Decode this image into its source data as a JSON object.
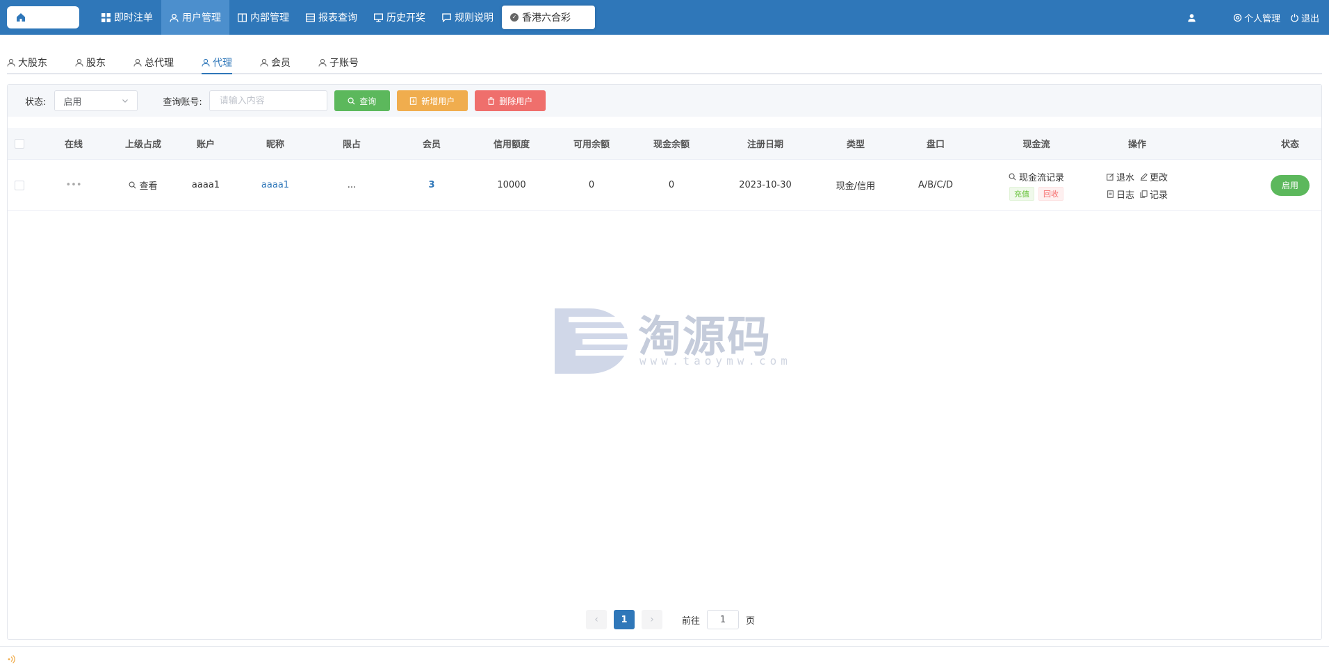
{
  "topbar": {
    "nav": [
      "即时注单",
      "用户管理",
      "内部管理",
      "报表查询",
      "历史开奖",
      "规则说明"
    ],
    "active_nav": "用户管理",
    "lottery": "香港六合彩",
    "right": [
      "个人管理",
      "退出"
    ],
    "accent": "#2f77b9"
  },
  "tabs": [
    "大股东",
    "股东",
    "总代理",
    "代理",
    "会员",
    "子账号"
  ],
  "active_tab": "代理",
  "filter": {
    "status_label": "状态:",
    "status_value": "启用",
    "query_label": "查询账号:",
    "query_placeholder": "请输入内容",
    "search_btn": "查询",
    "add_btn": "新增用户",
    "delete_btn": "删除用户"
  },
  "table": {
    "headers": [
      "在线",
      "上级占成",
      "账户",
      "昵称",
      "限占",
      "会员",
      "信用额度",
      "可用余额",
      "现金余额",
      "注册日期",
      "类型",
      "盘口",
      "现金流",
      "操作",
      "状态"
    ],
    "row": {
      "online": "•••",
      "parent_share": "查看",
      "account": "aaaa1",
      "nickname": "aaaa1",
      "limit": "...",
      "members": "3",
      "credit": "10000",
      "available": "0",
      "cash": "0",
      "reg_date": "2023-10-30",
      "type": "现金/信用",
      "plate": "A/B/C/D",
      "cashflow_record": "现金流记录",
      "recharge": "充值",
      "recycle": "回收",
      "op_rebate": "退水",
      "op_edit": "更改",
      "op_log": "日志",
      "op_record": "记录",
      "status": "启用"
    }
  },
  "pager": {
    "current": "1",
    "goto_label": "前往",
    "goto_value": "1",
    "page_unit": "页"
  },
  "watermark": {
    "main": "淘源码",
    "sub": "www.taoymw.com"
  }
}
